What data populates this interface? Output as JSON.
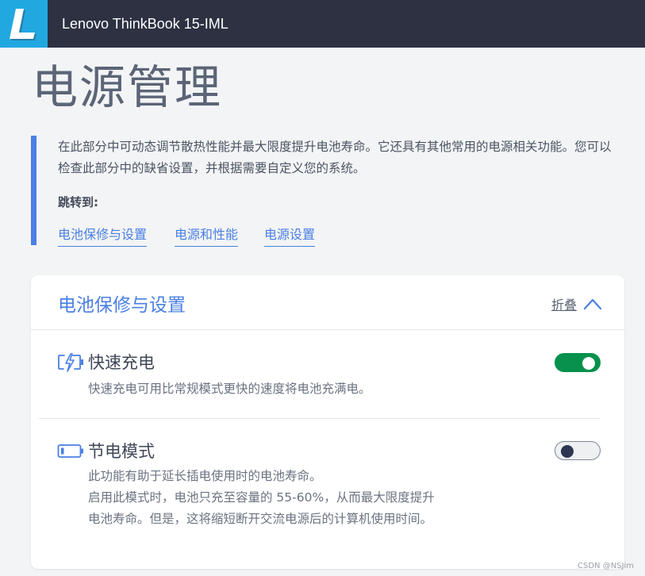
{
  "header": {
    "logo_letter": "L",
    "model_name": "Lenovo ThinkBook 15-IML"
  },
  "page": {
    "title": "电源管理",
    "intro": "在此部分中可动态调节散热性能并最大限度提升电池寿命。它还具有其他常用的电源相关功能。您可以检查此部分中的缺省设置，并根据需要自定义您的系统。",
    "jump_label": "跳转到:",
    "jump_links": [
      "电池保修与设置",
      "电源和性能",
      "电源设置"
    ]
  },
  "card": {
    "title": "电池保修与设置",
    "collapse_label": "折叠",
    "features": [
      {
        "icon": "fast-charge-battery-icon",
        "title": "快速充电",
        "description_lines": [
          "快速充电可用比常规模式更快的速度将电池充满电。"
        ],
        "toggle_on": true
      },
      {
        "icon": "conservation-battery-icon",
        "title": "节电模式",
        "description_lines": [
          "此功能有助于延长插电使用时的电池寿命。",
          "启用此模式时，电池只充至容量的 55-60%，从而最大限度提升",
          "电池寿命。但是，这将缩短断开交流电源后的计算机使用时间。"
        ],
        "toggle_on": false
      }
    ]
  },
  "watermark": "CSDN @NSJim",
  "colors": {
    "header_bg": "#2d3142",
    "logo_bg": "#21a8e1",
    "accent": "#4a7fe3",
    "toggle_on": "#07914c",
    "background": "#f3f4f5"
  }
}
